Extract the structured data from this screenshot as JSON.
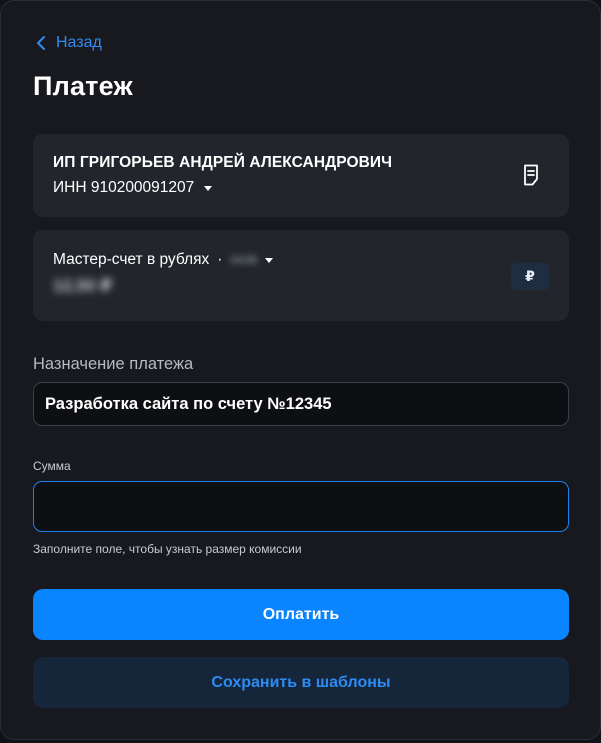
{
  "header": {
    "back_label": "Назад",
    "title": "Платеж"
  },
  "recipient": {
    "name": "ИП ГРИГОРЬЕВ АНДРЕЙ АЛЕКСАНДРОВИЧ",
    "inn": "ИНН 910200091207",
    "icon": "document-icon"
  },
  "account": {
    "name": "Мастер-счет в рублях",
    "separator": "·",
    "masked_number": "0439",
    "balance": "12,50 ₽",
    "currency_badge": "₽"
  },
  "form": {
    "purpose_label": "Назначение платежа",
    "purpose_value": "Разработка сайта по счету №12345",
    "sum_label": "Сумма",
    "sum_value": "",
    "hint": "Заполните поле, чтобы узнать размер комиссии"
  },
  "actions": {
    "pay_label": "Оплатить",
    "save_label": "Сохранить в шаблоны"
  },
  "colors": {
    "accent": "#0a84ff",
    "background": "#17191e",
    "card": "#22262c"
  }
}
